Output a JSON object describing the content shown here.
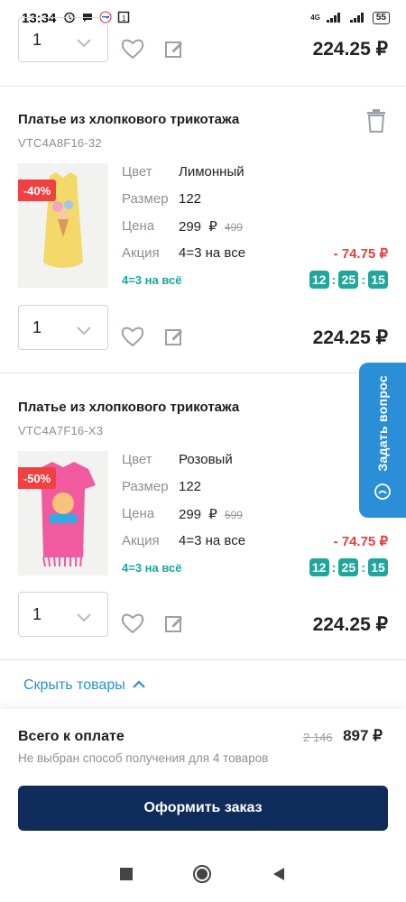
{
  "status": {
    "time": "13:34",
    "network": "4G",
    "battery": "55"
  },
  "currency": "₽",
  "labels": {
    "color": "Цвет",
    "size": "Размер",
    "price": "Цена",
    "promo": "Акция"
  },
  "items": [
    {
      "qty": "1",
      "total": "224.25 ₽"
    },
    {
      "title": "Платье из хлопкового трикотажа",
      "sku": "VTC4A8F16-32",
      "discount_badge": "-40%",
      "color": "Лимонный",
      "size": "122",
      "price": "299",
      "old_price": "499",
      "promo": "4=3 на все",
      "promo_discount": "- 74.75 ₽",
      "promo_tag": "4=3 на всё",
      "timer": [
        "12",
        "25",
        "15"
      ],
      "qty": "1",
      "total": "224.25 ₽",
      "image_color": "#f4d86a"
    },
    {
      "title": "Платье из хлопкового трикотажа",
      "sku": "VTC4A7F16-X3",
      "discount_badge": "-50%",
      "color": "Розовый",
      "size": "122",
      "price": "299",
      "old_price": "599",
      "promo": "4=3 на все",
      "promo_discount": "- 74.75 ₽",
      "promo_tag": "4=3 на всё",
      "timer": [
        "12",
        "25",
        "15"
      ],
      "qty": "1",
      "total": "224.25 ₽",
      "image_color": "#f25aa0"
    }
  ],
  "ask_question": "Задать вопрос",
  "hide_goods": "Скрыть товары",
  "summary": {
    "title": "Всего к оплате",
    "old_total": "2 146",
    "total": "897 ₽",
    "note": "Не выбран способ получения для 4 товаров",
    "checkout": "Оформить заказ"
  },
  "colors": {
    "accent_blue": "#2a8fd6",
    "checkout_navy": "#0f2c5a",
    "discount_red": "#ef4141",
    "timer_teal": "#20a69c"
  },
  "icons": [
    "heart-icon",
    "edit-icon",
    "trash-icon",
    "chevron-down-icon",
    "chevron-up-icon",
    "chat-icon"
  ]
}
